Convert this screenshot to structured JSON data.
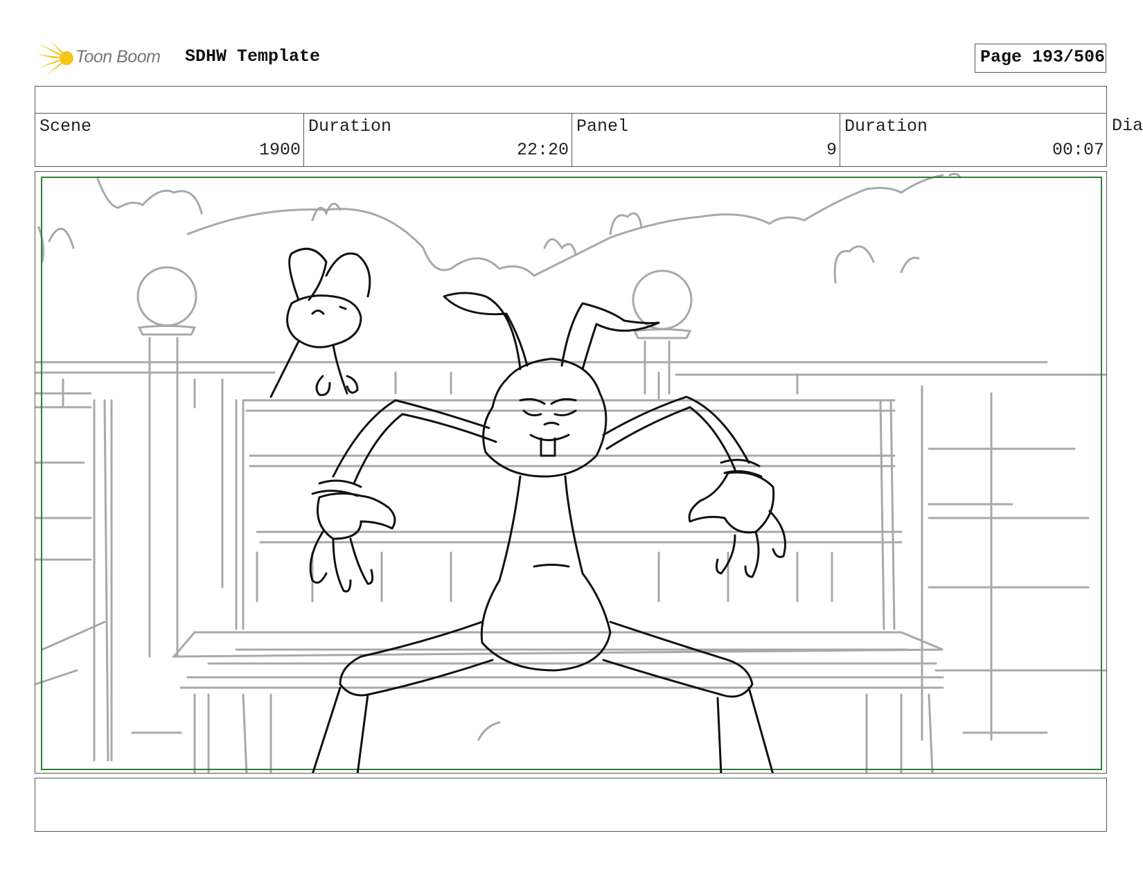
{
  "header": {
    "logo_text": "Toon Boom",
    "title": "SDHW Template",
    "page_label": "Page 193/506"
  },
  "info": {
    "scene_label": "Scene",
    "scene_value": "1900",
    "scene_duration_label": "Duration",
    "scene_duration_value": "22:20",
    "panel_label": "Panel",
    "panel_value": "9",
    "panel_duration_label": "Duration",
    "panel_duration_value": "00:07",
    "dialogue_label": "Dia"
  },
  "colors": {
    "safe_area": "#2e7d32",
    "logo_yellow": "#f5c518",
    "sketch_background": "#a8a8a8",
    "sketch_character": "#111111"
  }
}
